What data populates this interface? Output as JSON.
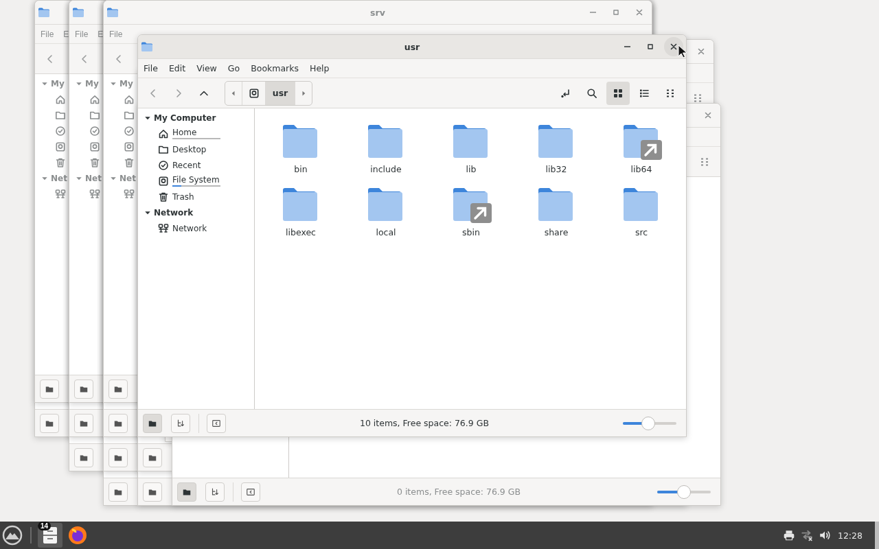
{
  "background_windows": [
    {
      "menu": [
        "File",
        "E"
      ],
      "sidebar_sections": [
        "My",
        "Net"
      ]
    },
    {
      "menu": [
        "File",
        "E"
      ],
      "sidebar_sections": [
        "My",
        "Net"
      ]
    },
    {
      "title": "srv",
      "menu": [
        "File"
      ],
      "sidebar_sections": [
        "My",
        "Net"
      ]
    }
  ],
  "lower_window": {
    "status": "0 items, Free space: 76.9 GB",
    "zoom": {
      "level": 0.5
    }
  },
  "window": {
    "title": "usr",
    "menu": [
      "File",
      "Edit",
      "View",
      "Go",
      "Bookmarks",
      "Help"
    ],
    "path": [
      {
        "kind": "drive",
        "selected": false
      },
      {
        "kind": "folder",
        "label": "usr",
        "selected": true
      }
    ],
    "view_modes": [
      {
        "kind": "icons",
        "selected": true
      },
      {
        "kind": "list",
        "selected": false
      },
      {
        "kind": "compact",
        "selected": false
      }
    ],
    "sidebar": [
      {
        "title": "My Computer",
        "expanded": true,
        "items": [
          {
            "kind": "home",
            "label": "Home",
            "level": 0
          },
          {
            "kind": "desktop",
            "label": "Desktop"
          },
          {
            "kind": "recent",
            "label": "Recent"
          },
          {
            "kind": "drive",
            "label": "File System",
            "level": 0.18
          },
          {
            "kind": "trash",
            "label": "Trash"
          }
        ]
      },
      {
        "title": "Network",
        "expanded": true,
        "items": [
          {
            "kind": "network",
            "label": "Network"
          }
        ]
      }
    ],
    "files": [
      {
        "name": "bin",
        "symlink": false
      },
      {
        "name": "include",
        "symlink": false
      },
      {
        "name": "lib",
        "symlink": false
      },
      {
        "name": "lib32",
        "symlink": false
      },
      {
        "name": "lib64",
        "symlink": true
      },
      {
        "name": "libexec",
        "symlink": false
      },
      {
        "name": "local",
        "symlink": false
      },
      {
        "name": "sbin",
        "symlink": true
      },
      {
        "name": "share",
        "symlink": false
      },
      {
        "name": "src",
        "symlink": false
      }
    ],
    "pane_buttons": [
      {
        "kind": "places",
        "selected": true
      },
      {
        "kind": "tree",
        "selected": false
      }
    ],
    "status": "10 items, Free space: 76.9 GB",
    "zoom": {
      "level": 0.48
    }
  },
  "taskbar": {
    "apps": [
      {
        "kind": "files",
        "badge": "14",
        "selected": true
      },
      {
        "kind": "browser",
        "selected": false
      }
    ],
    "clock": "12:28"
  }
}
